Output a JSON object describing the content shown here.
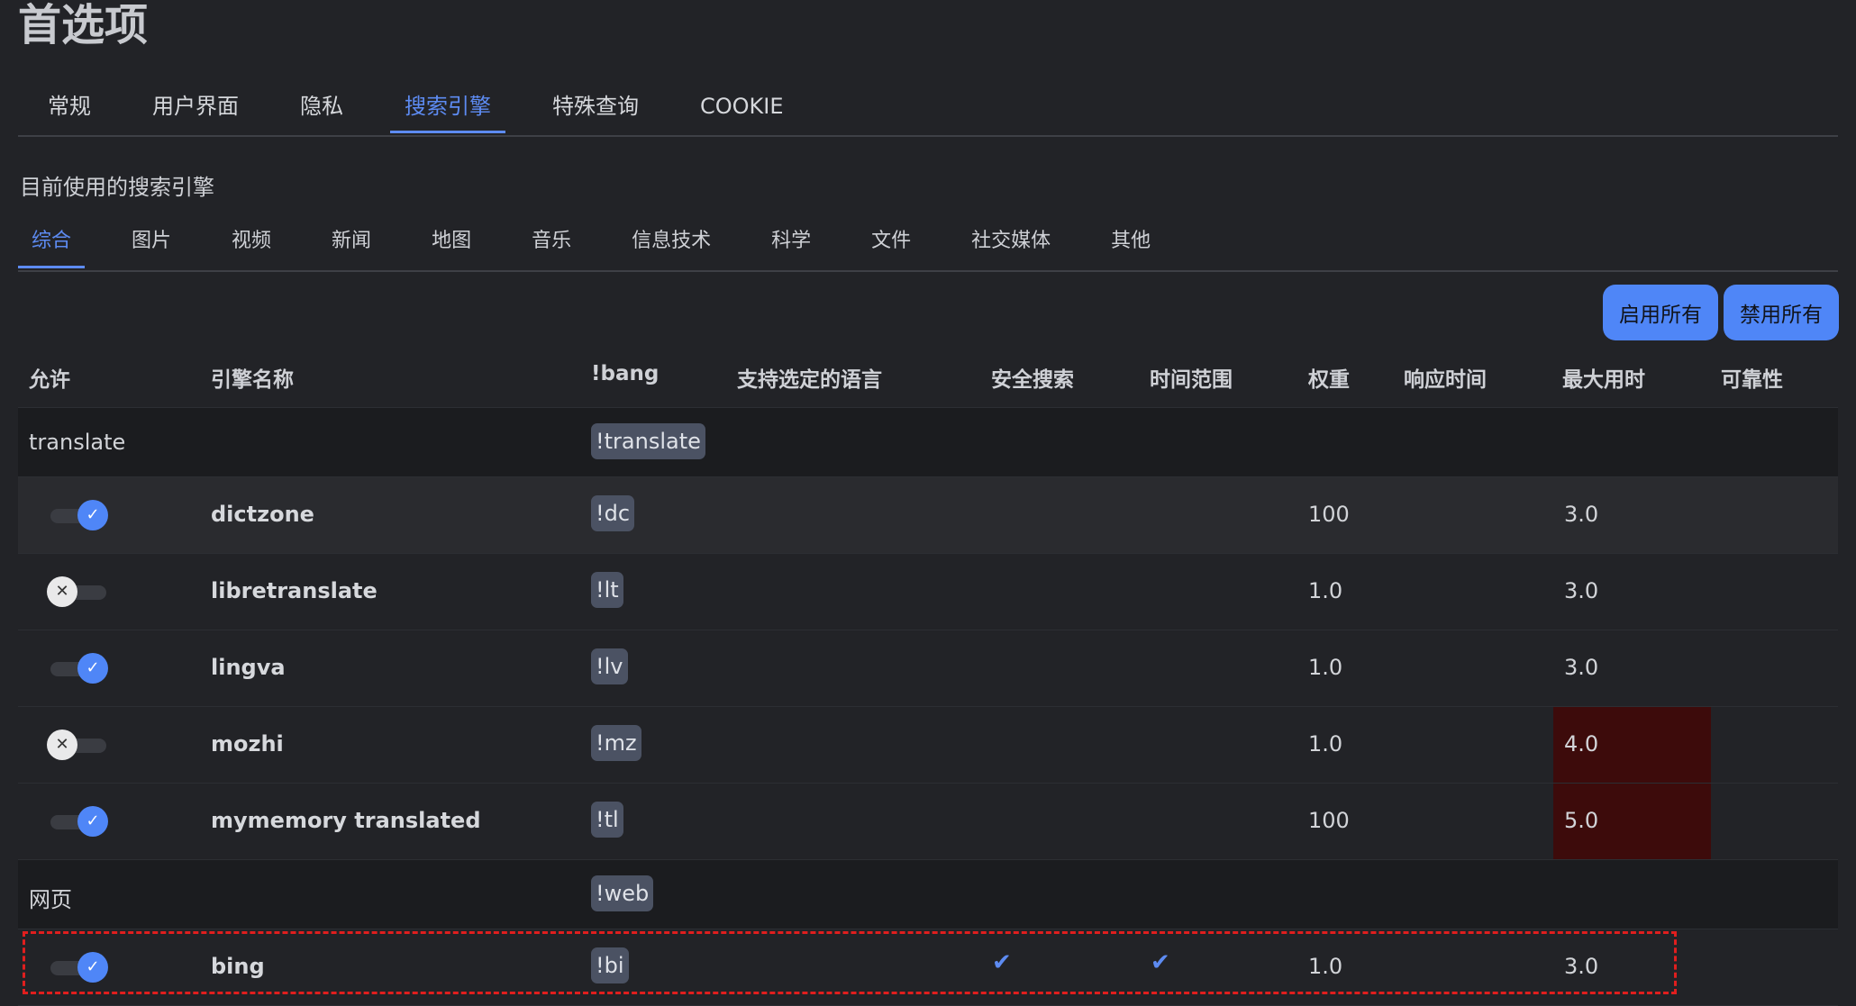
{
  "page": {
    "title": "首选项"
  },
  "top_tabs": [
    "常规",
    "用户界面",
    "隐私",
    "搜索引擎",
    "特殊查询",
    "COOKIE"
  ],
  "section_label": "目前使用的搜索引擎",
  "category_tabs": [
    "综合",
    "图片",
    "视频",
    "新闻",
    "地图",
    "音乐",
    "信息技术",
    "科学",
    "文件",
    "社交媒体",
    "其他"
  ],
  "buttons": {
    "enable_all": "启用所有",
    "disable_all": "禁用所有"
  },
  "table": {
    "headers": [
      "允许",
      "引擎名称",
      "!bang",
      "支持选定的语言",
      "安全搜索",
      "时间范围",
      "权重",
      "响应时间",
      "最大用时",
      "可靠性"
    ],
    "groups": [
      {
        "name": "translate",
        "bang": "!translate"
      },
      {
        "name": "网页",
        "bang": "!web"
      }
    ],
    "rows": [
      {
        "enabled": true,
        "name": "dictzone",
        "bang": "!dc",
        "weight": "100",
        "max_time": "3.0"
      },
      {
        "enabled": false,
        "name": "libretranslate",
        "bang": "!lt",
        "weight": "1.0",
        "max_time": "3.0"
      },
      {
        "enabled": true,
        "name": "lingva",
        "bang": "!lv",
        "weight": "1.0",
        "max_time": "3.0"
      },
      {
        "enabled": false,
        "name": "mozhi",
        "bang": "!mz",
        "weight": "1.0",
        "max_time": "4.0"
      },
      {
        "enabled": true,
        "name": "mymemory translated",
        "bang": "!tl",
        "weight": "100",
        "max_time": "5.0"
      },
      {
        "enabled": true,
        "name": "bing",
        "bang": "!bi",
        "weight": "1.0",
        "max_time": "3.0",
        "safe_search": true,
        "time_range": true
      }
    ]
  },
  "icons": {
    "toggle_on": "check-icon",
    "toggle_off": "x-icon",
    "supported": "checkmark-icon"
  },
  "colors": {
    "accent": "#5d8bf2",
    "warning_bg": "#3d0b0b",
    "highlight_border": "#e01e1e"
  },
  "glyphs": {
    "check": "✓",
    "x": "✕",
    "supported": "✔"
  }
}
